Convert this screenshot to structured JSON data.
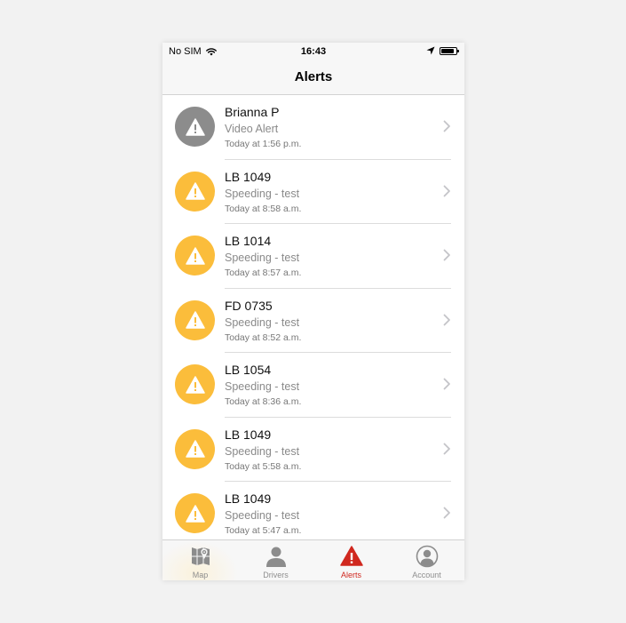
{
  "status_bar": {
    "carrier": "No SIM",
    "time": "16:43",
    "icons": [
      "wifi-icon",
      "location-arrow-icon",
      "battery-icon"
    ]
  },
  "nav": {
    "title": "Alerts"
  },
  "alerts": [
    {
      "name": "Brianna P",
      "type": "Video Alert",
      "time": "Today at 1:56 p.m.",
      "color": "#8c8c8c"
    },
    {
      "name": "LB 1049",
      "type": "Speeding - test",
      "time": "Today at 8:58 a.m.",
      "color": "#fbbd3b"
    },
    {
      "name": "LB 1014",
      "type": "Speeding - test",
      "time": "Today at 8:57 a.m.",
      "color": "#fbbd3b"
    },
    {
      "name": "FD 0735",
      "type": "Speeding - test",
      "time": "Today at 8:52 a.m.",
      "color": "#fbbd3b"
    },
    {
      "name": "LB 1054",
      "type": "Speeding - test",
      "time": "Today at 8:36 a.m.",
      "color": "#fbbd3b"
    },
    {
      "name": "LB 1049",
      "type": "Speeding - test",
      "time": "Today at 5:58 a.m.",
      "color": "#fbbd3b"
    },
    {
      "name": "LB 1049",
      "type": "Speeding - test",
      "time": "Today at 5:47 a.m.",
      "color": "#fbbd3b"
    }
  ],
  "tabs": [
    {
      "label": "Map",
      "icon": "map-icon"
    },
    {
      "label": "Drivers",
      "icon": "driver-icon"
    },
    {
      "label": "Alerts",
      "icon": "alert-triangle-icon",
      "active": true
    },
    {
      "label": "Account",
      "icon": "account-icon"
    }
  ],
  "colors": {
    "active_tab": "#d0281f",
    "warning": "#fbbd3b",
    "video": "#8c8c8c"
  }
}
